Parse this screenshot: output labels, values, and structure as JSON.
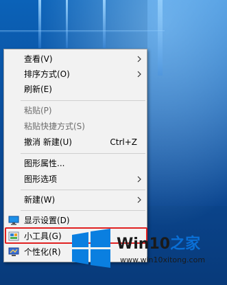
{
  "context_menu": {
    "items": [
      {
        "label": "查看(V)",
        "has_submenu": true,
        "enabled": true
      },
      {
        "label": "排序方式(O)",
        "has_submenu": true,
        "enabled": true
      },
      {
        "label": "刷新(E)",
        "has_submenu": false,
        "enabled": true
      },
      {
        "label": "粘贴(P)",
        "has_submenu": false,
        "enabled": false
      },
      {
        "label": "粘贴快捷方式(S)",
        "has_submenu": false,
        "enabled": false
      },
      {
        "label": "撤消 新建(U)",
        "shortcut": "Ctrl+Z",
        "has_submenu": false,
        "enabled": true
      },
      {
        "label": "图形属性...",
        "has_submenu": false,
        "enabled": true
      },
      {
        "label": "图形选项",
        "has_submenu": true,
        "enabled": true
      },
      {
        "label": "新建(W)",
        "has_submenu": true,
        "enabled": true
      },
      {
        "label": "显示设置(D)",
        "icon": "display-settings-icon",
        "has_submenu": false,
        "enabled": true
      },
      {
        "label": "小工具(G)",
        "icon": "gadgets-icon",
        "has_submenu": false,
        "enabled": true,
        "highlighted": true
      },
      {
        "label": "个性化(R)",
        "icon": "personalize-icon",
        "has_submenu": false,
        "enabled": true
      }
    ]
  },
  "watermark": {
    "brand_prefix": "Win10",
    "brand_suffix": "之家",
    "url": "www.win10xitong.com"
  },
  "colors": {
    "menu_background": "#f2f2f2",
    "highlight_border": "#e02020",
    "logo_blue": "#0a6fd6"
  }
}
